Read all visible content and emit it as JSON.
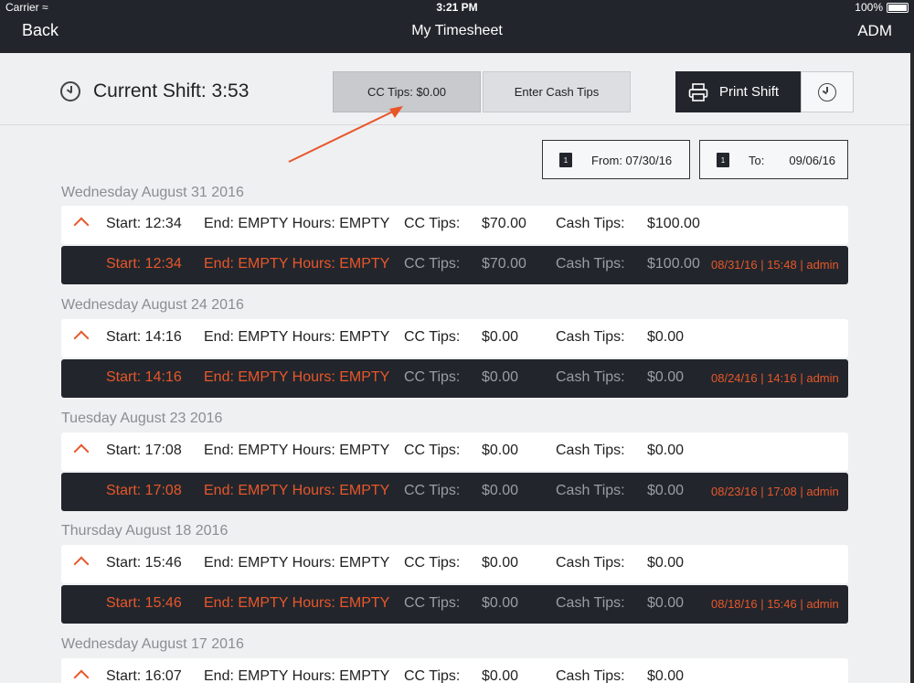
{
  "status_bar": {
    "carrier": "Carrier",
    "time": "3:21 PM",
    "battery": "100%"
  },
  "nav": {
    "back": "Back",
    "title": "My Timesheet",
    "user": "ADM"
  },
  "toolbar": {
    "current_shift": "Current Shift: 3:53",
    "cc_tips": "CC Tips: $0.00",
    "enter_cash_tips": "Enter Cash Tips",
    "print_shift": "Print Shift"
  },
  "date_range": {
    "from": "From: 07/30/16",
    "to_label": "To:",
    "to_value": "09/06/16"
  },
  "groups": [
    {
      "date": "Wednesday August 31 2016",
      "row": {
        "start": "Start: 12:34",
        "end": "End: EMPTY Hours: EMPTY",
        "cc_label": "CC Tips:",
        "cc_value": "$70.00",
        "cash_label": "Cash Tips:",
        "cash_value": "$100.00"
      },
      "detail": {
        "start": "Start: 12:34",
        "end": "End: EMPTY Hours: EMPTY",
        "cc_label": "CC Tips:",
        "cc_value": "$70.00",
        "cash_label": "Cash Tips:",
        "cash_value": "$100.00",
        "meta": "08/31/16 | 15:48 | admin"
      }
    },
    {
      "date": "Wednesday August 24 2016",
      "row": {
        "start": "Start: 14:16",
        "end": "End: EMPTY Hours: EMPTY",
        "cc_label": "CC Tips:",
        "cc_value": "$0.00",
        "cash_label": "Cash Tips:",
        "cash_value": "$0.00"
      },
      "detail": {
        "start": "Start: 14:16",
        "end": "End: EMPTY Hours: EMPTY",
        "cc_label": "CC Tips:",
        "cc_value": "$0.00",
        "cash_label": "Cash Tips:",
        "cash_value": "$0.00",
        "meta": "08/24/16 | 14:16 | admin"
      }
    },
    {
      "date": "Tuesday August 23 2016",
      "row": {
        "start": "Start: 17:08",
        "end": "End: EMPTY Hours: EMPTY",
        "cc_label": "CC Tips:",
        "cc_value": "$0.00",
        "cash_label": "Cash Tips:",
        "cash_value": "$0.00"
      },
      "detail": {
        "start": "Start: 17:08",
        "end": "End: EMPTY Hours: EMPTY",
        "cc_label": "CC Tips:",
        "cc_value": "$0.00",
        "cash_label": "Cash Tips:",
        "cash_value": "$0.00",
        "meta": "08/23/16 | 17:08 | admin"
      }
    },
    {
      "date": "Thursday August 18 2016",
      "row": {
        "start": "Start: 15:46",
        "end": "End: EMPTY Hours: EMPTY",
        "cc_label": "CC Tips:",
        "cc_value": "$0.00",
        "cash_label": "Cash Tips:",
        "cash_value": "$0.00"
      },
      "detail": {
        "start": "Start: 15:46",
        "end": "End: EMPTY Hours: EMPTY",
        "cc_label": "CC Tips:",
        "cc_value": "$0.00",
        "cash_label": "Cash Tips:",
        "cash_value": "$0.00",
        "meta": "08/18/16 | 15:46 | admin"
      }
    },
    {
      "date": "Wednesday August 17 2016",
      "row": {
        "start": "Start: 16:07",
        "end": "End: EMPTY Hours: EMPTY",
        "cc_label": "CC Tips:",
        "cc_value": "$0.00",
        "cash_label": "Cash Tips:",
        "cash_value": "$0.00"
      }
    }
  ],
  "colors": {
    "accent": "#e8562a",
    "dark": "#22262c",
    "background": "#eff0f2"
  }
}
